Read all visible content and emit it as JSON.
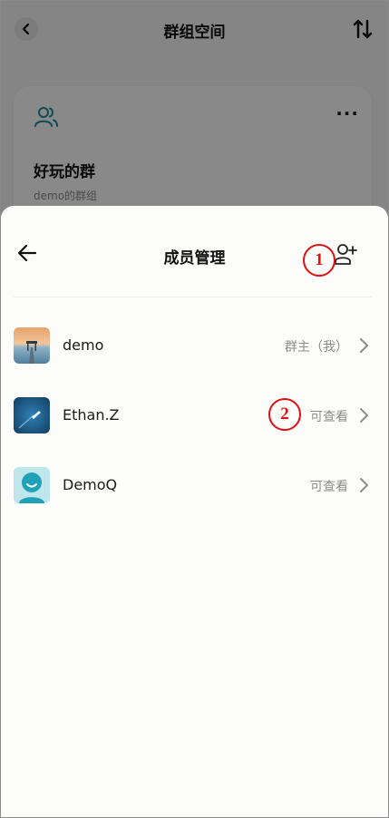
{
  "background": {
    "title": "群组空间",
    "group_name": "好玩的群",
    "group_desc": "demo的群组",
    "more_label": "···"
  },
  "sheet": {
    "title": "成员管理"
  },
  "members": [
    {
      "name": "demo",
      "role": "群主（我）",
      "avatar": "sunset-pier-photo"
    },
    {
      "name": "Ethan.Z",
      "role": "可查看",
      "avatar": "boat-ocean-photo"
    },
    {
      "name": "DemoQ",
      "role": "可查看",
      "avatar": "default-user-avatar"
    }
  ],
  "annotations": [
    {
      "label": "1"
    },
    {
      "label": "2"
    }
  ],
  "colors": {
    "accent": "#1a8a9a",
    "marker": "#e01010",
    "secondary_text": "#8d8d8d"
  }
}
